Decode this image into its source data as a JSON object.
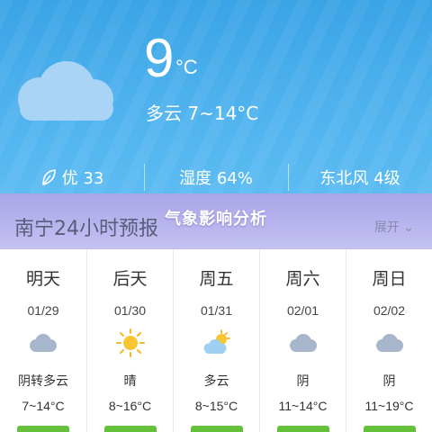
{
  "current": {
    "icon": "cloud-moon-icon",
    "temperature": "9",
    "unit": "°C",
    "condition": "多云 7~14°C"
  },
  "stats": {
    "air_quality": "优 33",
    "humidity": "湿度 64%",
    "wind": "东北风 4级"
  },
  "overlay_title": "气象影响分析",
  "forecast": {
    "title": "南宁24小时预报",
    "expand_label": "展开",
    "days": [
      {
        "day": "明天",
        "date": "01/29",
        "icon": "cloud-icon",
        "desc": "阴转多云",
        "temp": "7~14°C"
      },
      {
        "day": "后天",
        "date": "01/30",
        "icon": "sun-icon",
        "desc": "晴",
        "temp": "8~16°C"
      },
      {
        "day": "周五",
        "date": "01/31",
        "icon": "partly-cloudy-icon",
        "desc": "多云",
        "temp": "8~15°C"
      },
      {
        "day": "周六",
        "date": "02/01",
        "icon": "cloud-icon",
        "desc": "阴",
        "temp": "11~14°C"
      },
      {
        "day": "周日",
        "date": "02/02",
        "icon": "cloud-icon",
        "desc": "阴",
        "temp": "11~19°C"
      }
    ]
  },
  "colors": {
    "sky": "#4fb2ee",
    "aqi_good": "#63c23a",
    "band": "#b5b2ee"
  }
}
